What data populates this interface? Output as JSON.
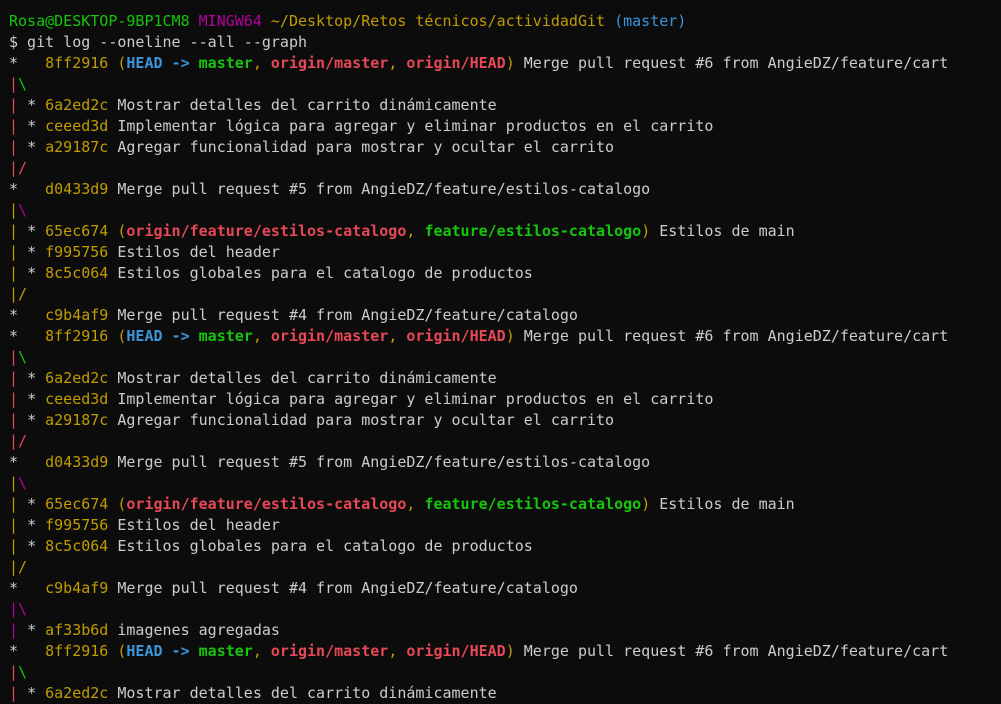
{
  "window": {
    "title": ""
  },
  "prompt": {
    "user_host": "Rosa@DESKTOP-9BP1CM8",
    "system": "MINGW64",
    "path": "~/Desktop/Retos técnicos/actividadGit",
    "branch": "(master)"
  },
  "command": "$ git log --oneline --all --graph",
  "colors": {
    "background": "#0c0c0c",
    "text": "#cccccc",
    "green": "#16c60c",
    "magenta": "#b4009e",
    "yellow": "#c19c00",
    "blue": "#3a96dd",
    "red": "#e74856"
  },
  "log_lines": [
    {
      "kind": "commit",
      "graph": [
        {
          "t": "*   ",
          "c": "white"
        }
      ],
      "hash": "8ff2916",
      "refs": [
        {
          "t": "HEAD",
          "c": "head"
        },
        {
          "t": " -> ",
          "c": "arrow"
        },
        {
          "t": "master",
          "c": "local"
        },
        {
          "t": ", ",
          "c": "paren"
        },
        {
          "t": "origin/master",
          "c": "remote"
        },
        {
          "t": ", ",
          "c": "paren"
        },
        {
          "t": "origin/HEAD",
          "c": "remote"
        }
      ],
      "message": "Merge pull request #6 from AngieDZ/feature/cart"
    },
    {
      "kind": "graph",
      "graph": [
        {
          "t": "|",
          "c": "red"
        },
        {
          "t": "\\",
          "c": "green"
        }
      ]
    },
    {
      "kind": "commit",
      "graph": [
        {
          "t": "| ",
          "c": "red"
        },
        {
          "t": "* ",
          "c": "white"
        }
      ],
      "hash": "6a2ed2c",
      "refs": [],
      "message": "Mostrar detalles del carrito dinámicamente"
    },
    {
      "kind": "commit",
      "graph": [
        {
          "t": "| ",
          "c": "red"
        },
        {
          "t": "* ",
          "c": "white"
        }
      ],
      "hash": "ceeed3d",
      "refs": [],
      "message": "Implementar lógica para agregar y eliminar productos en el carrito"
    },
    {
      "kind": "commit",
      "graph": [
        {
          "t": "| ",
          "c": "red"
        },
        {
          "t": "* ",
          "c": "white"
        }
      ],
      "hash": "a29187c",
      "refs": [],
      "message": "Agregar funcionalidad para mostrar y ocultar el carrito"
    },
    {
      "kind": "graph",
      "graph": [
        {
          "t": "|",
          "c": "red"
        },
        {
          "t": "/",
          "c": "red"
        }
      ]
    },
    {
      "kind": "commit",
      "graph": [
        {
          "t": "*   ",
          "c": "white"
        }
      ],
      "hash": "d0433d9",
      "refs": [],
      "message": "Merge pull request #5 from AngieDZ/feature/estilos-catalogo"
    },
    {
      "kind": "graph",
      "graph": [
        {
          "t": "|",
          "c": "yellow"
        },
        {
          "t": "\\",
          "c": "magenta"
        }
      ]
    },
    {
      "kind": "commit",
      "graph": [
        {
          "t": "| ",
          "c": "yellow"
        },
        {
          "t": "* ",
          "c": "white"
        }
      ],
      "hash": "65ec674",
      "refs": [
        {
          "t": "origin/feature/estilos-catalogo",
          "c": "remote"
        },
        {
          "t": ", ",
          "c": "paren"
        },
        {
          "t": "feature/estilos-catalogo",
          "c": "local"
        }
      ],
      "message": "Estilos de main"
    },
    {
      "kind": "commit",
      "graph": [
        {
          "t": "| ",
          "c": "yellow"
        },
        {
          "t": "* ",
          "c": "white"
        }
      ],
      "hash": "f995756",
      "refs": [],
      "message": "Estilos del header"
    },
    {
      "kind": "commit",
      "graph": [
        {
          "t": "| ",
          "c": "yellow"
        },
        {
          "t": "* ",
          "c": "white"
        }
      ],
      "hash": "8c5c064",
      "refs": [],
      "message": "Estilos globales para el catalogo de productos"
    },
    {
      "kind": "graph",
      "graph": [
        {
          "t": "|",
          "c": "yellow"
        },
        {
          "t": "/",
          "c": "yellow"
        }
      ]
    },
    {
      "kind": "commit",
      "graph": [
        {
          "t": "*   ",
          "c": "white"
        }
      ],
      "hash": "c9b4af9",
      "refs": [],
      "message": "Merge pull request #4 from AngieDZ/feature/catalogo"
    },
    {
      "kind": "commit",
      "graph": [
        {
          "t": "*   ",
          "c": "white"
        }
      ],
      "hash": "8ff2916",
      "refs": [
        {
          "t": "HEAD",
          "c": "head"
        },
        {
          "t": " -> ",
          "c": "arrow"
        },
        {
          "t": "master",
          "c": "local"
        },
        {
          "t": ", ",
          "c": "paren"
        },
        {
          "t": "origin/master",
          "c": "remote"
        },
        {
          "t": ", ",
          "c": "paren"
        },
        {
          "t": "origin/HEAD",
          "c": "remote"
        }
      ],
      "message": "Merge pull request #6 from AngieDZ/feature/cart"
    },
    {
      "kind": "graph",
      "graph": [
        {
          "t": "|",
          "c": "red"
        },
        {
          "t": "\\",
          "c": "green"
        }
      ]
    },
    {
      "kind": "commit",
      "graph": [
        {
          "t": "| ",
          "c": "red"
        },
        {
          "t": "* ",
          "c": "white"
        }
      ],
      "hash": "6a2ed2c",
      "refs": [],
      "message": "Mostrar detalles del carrito dinámicamente"
    },
    {
      "kind": "commit",
      "graph": [
        {
          "t": "| ",
          "c": "red"
        },
        {
          "t": "* ",
          "c": "white"
        }
      ],
      "hash": "ceeed3d",
      "refs": [],
      "message": "Implementar lógica para agregar y eliminar productos en el carrito"
    },
    {
      "kind": "commit",
      "graph": [
        {
          "t": "| ",
          "c": "red"
        },
        {
          "t": "* ",
          "c": "white"
        }
      ],
      "hash": "a29187c",
      "refs": [],
      "message": "Agregar funcionalidad para mostrar y ocultar el carrito"
    },
    {
      "kind": "graph",
      "graph": [
        {
          "t": "|",
          "c": "red"
        },
        {
          "t": "/",
          "c": "red"
        }
      ]
    },
    {
      "kind": "commit",
      "graph": [
        {
          "t": "*   ",
          "c": "white"
        }
      ],
      "hash": "d0433d9",
      "refs": [],
      "message": "Merge pull request #5 from AngieDZ/feature/estilos-catalogo"
    },
    {
      "kind": "graph",
      "graph": [
        {
          "t": "|",
          "c": "yellow"
        },
        {
          "t": "\\",
          "c": "magenta"
        }
      ]
    },
    {
      "kind": "commit",
      "graph": [
        {
          "t": "| ",
          "c": "yellow"
        },
        {
          "t": "* ",
          "c": "white"
        }
      ],
      "hash": "65ec674",
      "refs": [
        {
          "t": "origin/feature/estilos-catalogo",
          "c": "remote"
        },
        {
          "t": ", ",
          "c": "paren"
        },
        {
          "t": "feature/estilos-catalogo",
          "c": "local"
        }
      ],
      "message": "Estilos de main"
    },
    {
      "kind": "commit",
      "graph": [
        {
          "t": "| ",
          "c": "yellow"
        },
        {
          "t": "* ",
          "c": "white"
        }
      ],
      "hash": "f995756",
      "refs": [],
      "message": "Estilos del header"
    },
    {
      "kind": "commit",
      "graph": [
        {
          "t": "| ",
          "c": "yellow"
        },
        {
          "t": "* ",
          "c": "white"
        }
      ],
      "hash": "8c5c064",
      "refs": [],
      "message": "Estilos globales para el catalogo de productos"
    },
    {
      "kind": "graph",
      "graph": [
        {
          "t": "|",
          "c": "yellow"
        },
        {
          "t": "/",
          "c": "yellow"
        }
      ]
    },
    {
      "kind": "commit",
      "graph": [
        {
          "t": "*   ",
          "c": "white"
        }
      ],
      "hash": "c9b4af9",
      "refs": [],
      "message": "Merge pull request #4 from AngieDZ/feature/catalogo"
    },
    {
      "kind": "graph",
      "graph": [
        {
          "t": "|",
          "c": "magenta"
        },
        {
          "t": "\\",
          "c": "magenta"
        }
      ]
    },
    {
      "kind": "commit",
      "graph": [
        {
          "t": "| ",
          "c": "magenta"
        },
        {
          "t": "* ",
          "c": "white"
        }
      ],
      "hash": "af33b6d",
      "refs": [],
      "message": "imagenes agregadas"
    },
    {
      "kind": "commit",
      "graph": [
        {
          "t": "*   ",
          "c": "white"
        }
      ],
      "hash": "8ff2916",
      "refs": [
        {
          "t": "HEAD",
          "c": "head"
        },
        {
          "t": " -> ",
          "c": "arrow"
        },
        {
          "t": "master",
          "c": "local"
        },
        {
          "t": ", ",
          "c": "paren"
        },
        {
          "t": "origin/master",
          "c": "remote"
        },
        {
          "t": ", ",
          "c": "paren"
        },
        {
          "t": "origin/HEAD",
          "c": "remote"
        }
      ],
      "message": "Merge pull request #6 from AngieDZ/feature/cart"
    },
    {
      "kind": "graph",
      "graph": [
        {
          "t": "|",
          "c": "red"
        },
        {
          "t": "\\",
          "c": "green"
        }
      ]
    },
    {
      "kind": "commit",
      "graph": [
        {
          "t": "| ",
          "c": "red"
        },
        {
          "t": "* ",
          "c": "white"
        }
      ],
      "hash": "6a2ed2c",
      "refs": [],
      "message": "Mostrar detalles del carrito dinámicamente"
    }
  ]
}
